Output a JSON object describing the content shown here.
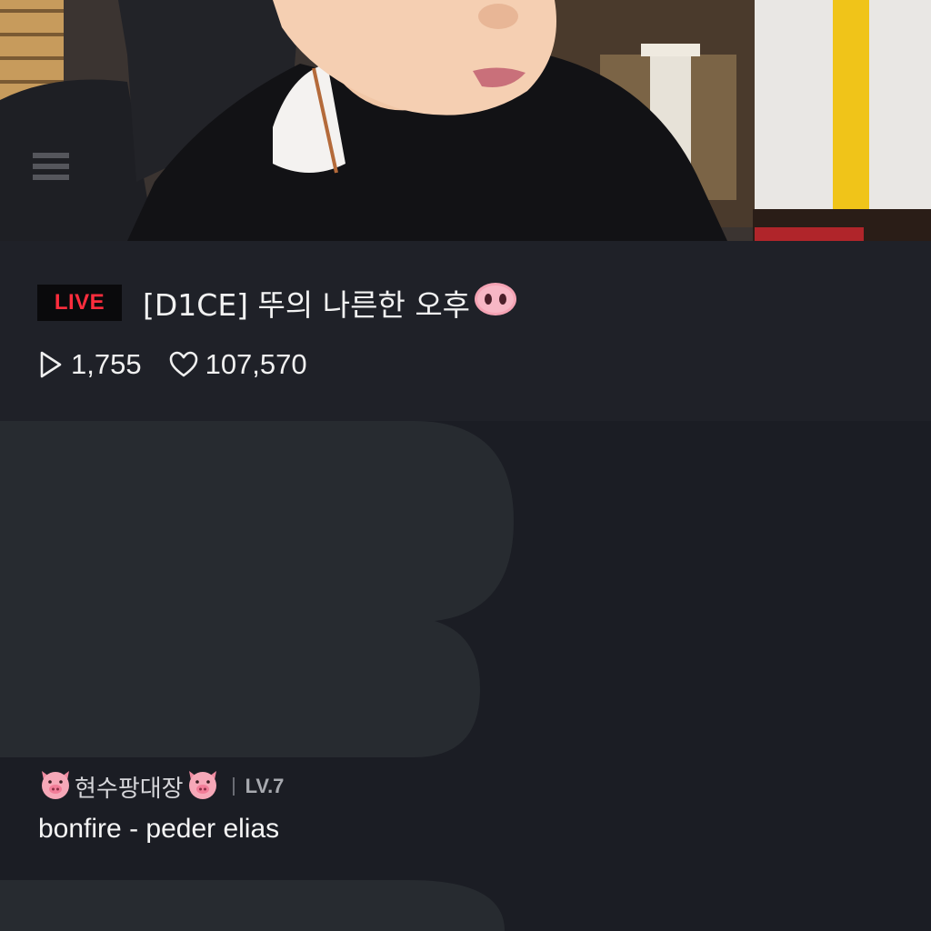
{
  "stream": {
    "live_label": "LIVE",
    "title": "[D1CE] 뚜의 나른한 오후",
    "title_emoji": "pig-nose-icon",
    "plays": "1,755",
    "likes": "107,570"
  },
  "chat": {
    "message": {
      "username": "현수팡대장",
      "badge_icon": "pig-face-icon",
      "level": "LV.7",
      "text": "bonfire - peder elias"
    }
  },
  "colors": {
    "live_red": "#ff2d3d",
    "background": "#1b1d24",
    "bubble": "#272b30"
  }
}
